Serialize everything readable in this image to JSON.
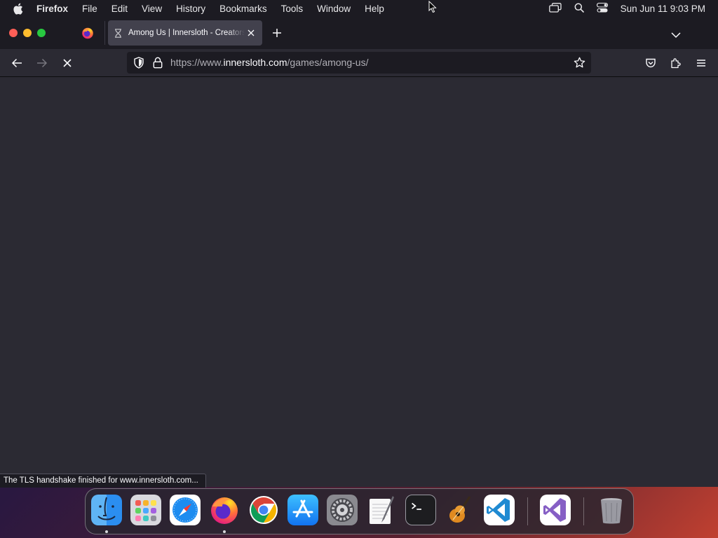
{
  "menubar": {
    "app_name": "Firefox",
    "items": [
      "File",
      "Edit",
      "View",
      "History",
      "Bookmarks",
      "Tools",
      "Window",
      "Help"
    ],
    "clock": "Sun Jun 11  9:03 PM",
    "icons": [
      "apple-logo-icon",
      "screen-mirroring-icon",
      "spotlight-search-icon",
      "control-center-icon"
    ]
  },
  "browser": {
    "tab": {
      "title": "Among Us | Innersloth - Creators of Among Us and The Henry Stickmin Collection",
      "state": "loading"
    },
    "url": {
      "prefix": "https://www.",
      "domain": "innersloth.com",
      "path": "/games/among-us/"
    },
    "status_text": "The TLS handshake finished for www.innersloth.com..."
  },
  "dock": {
    "apps": [
      {
        "name": "Finder",
        "running": true
      },
      {
        "name": "Launchpad",
        "running": false
      },
      {
        "name": "Safari",
        "running": false
      },
      {
        "name": "Firefox",
        "running": true
      },
      {
        "name": "Google Chrome",
        "running": false
      },
      {
        "name": "App Store",
        "running": false
      },
      {
        "name": "System Preferences",
        "running": false
      },
      {
        "name": "TextEdit",
        "running": false
      },
      {
        "name": "Terminal",
        "running": false
      },
      {
        "name": "GarageBand",
        "running": false
      },
      {
        "name": "Visual Studio Code",
        "running": false
      },
      {
        "name": "Visual Studio",
        "running": false
      },
      {
        "name": "Trash",
        "running": false
      }
    ]
  },
  "colors": {
    "toolbar": "#2b2a33",
    "tabstrip": "#1c1b22",
    "selected_tab": "#42414d",
    "url_text": "#fbfbfe"
  }
}
